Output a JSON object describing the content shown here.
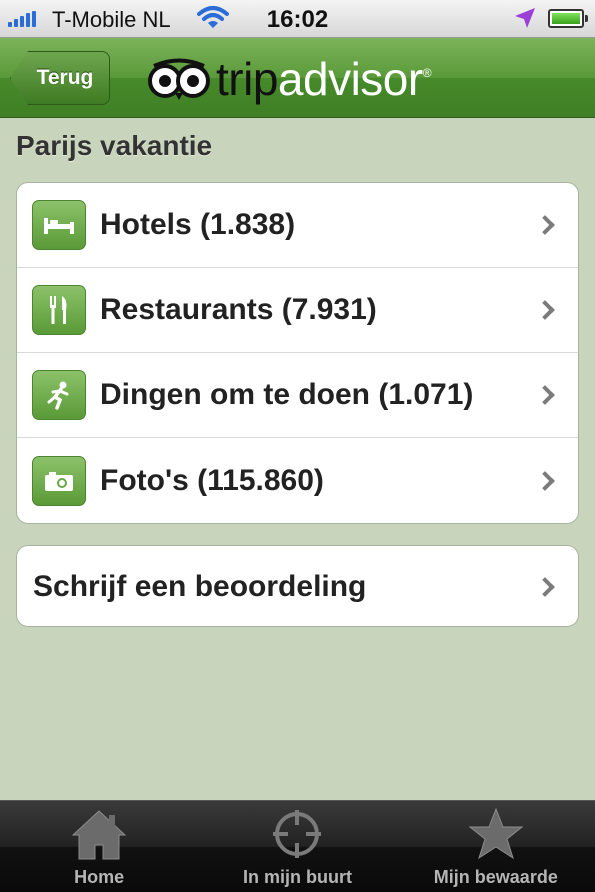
{
  "status_bar": {
    "carrier": "T-Mobile NL",
    "time": "16:02",
    "battery_level": 1.0,
    "signal_bars": 5
  },
  "nav_bar": {
    "back_label": "Terug",
    "logo_part1": "trip",
    "logo_part2": "advisor",
    "logo_reg": "®"
  },
  "page": {
    "title": "Parijs vakantie"
  },
  "categories": [
    {
      "label": "Hotels (1.838)",
      "icon": "bed-icon"
    },
    {
      "label": "Restaurants (7.931)",
      "icon": "fork-knife-icon"
    },
    {
      "label": "Dingen om te doen (1.071)",
      "icon": "running-person-icon"
    },
    {
      "label": "Foto's (115.860)",
      "icon": "camera-icon"
    }
  ],
  "review": {
    "label": "Schrijf een beoordeling"
  },
  "tab_bar": {
    "tabs": [
      {
        "label": "Home",
        "icon": "home-icon"
      },
      {
        "label": "In mijn buurt",
        "icon": "crosshair-icon"
      },
      {
        "label": "Mijn bewaarde",
        "icon": "star-icon"
      }
    ]
  },
  "colors": {
    "brand_green": "#589a38",
    "background": "#c9d4bd",
    "status_signal": "#2a6cd8",
    "location_arrow": "#9b3fd6"
  }
}
